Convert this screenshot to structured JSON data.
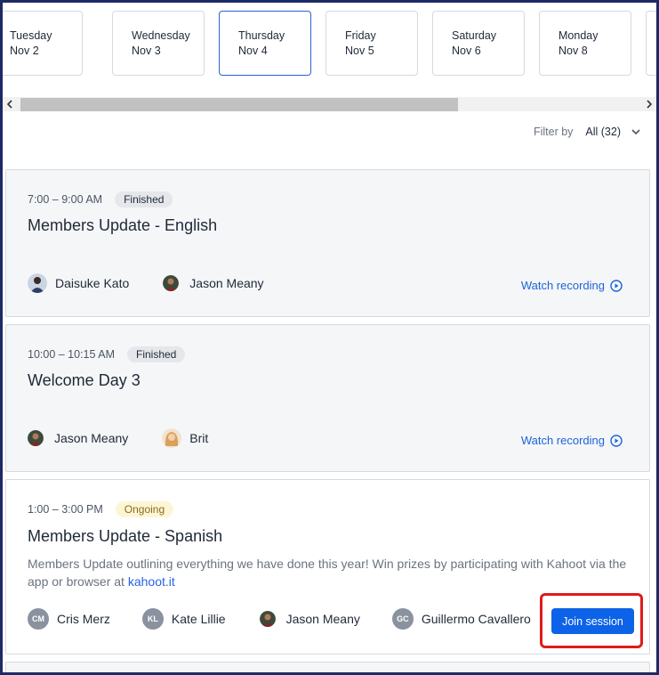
{
  "days": [
    {
      "name": "Tuesday",
      "date": "Nov 2"
    },
    {
      "name": "Wednesday",
      "date": "Nov 3"
    },
    {
      "name": "Thursday",
      "date": "Nov 4"
    },
    {
      "name": "Friday",
      "date": "Nov 5"
    },
    {
      "name": "Saturday",
      "date": "Nov 6"
    },
    {
      "name": "Monday",
      "date": "Nov 8"
    }
  ],
  "selected_day": "Thursday",
  "filter": {
    "label": "Filter by",
    "value": "All (32)"
  },
  "sessions": [
    {
      "time": "7:00 – 9:00 AM",
      "status": "Finished",
      "title": "Members Update - English",
      "speakers": [
        {
          "name": "Daisuke Kato",
          "avatar": "photo-avatar"
        },
        {
          "name": "Jason Meany",
          "avatar": "photo-avatar"
        }
      ],
      "action": "Watch recording"
    },
    {
      "time": "10:00 – 10:15 AM",
      "status": "Finished",
      "title": "Welcome Day 3",
      "speakers": [
        {
          "name": "Jason Meany",
          "avatar": "photo-avatar"
        },
        {
          "name": "Brit",
          "avatar": "photo-avatar"
        }
      ],
      "action": "Watch recording"
    },
    {
      "time": "1:00 – 3:00 PM",
      "status": "Ongoing",
      "title": "Members Update - Spanish",
      "description": "Members Update outlining everything we have done this year! Win prizes by participating with Kahoot via the app or browser at",
      "description_link": "kahoot.it",
      "speakers": [
        {
          "name": "Cris Merz",
          "initials": "CM"
        },
        {
          "name": "Kate Lillie",
          "initials": "KL"
        },
        {
          "name": "Jason Meany",
          "avatar": "photo-avatar"
        },
        {
          "name": "Guillermo Cavallero",
          "initials": "GC"
        }
      ],
      "action": "Join session"
    }
  ],
  "colors": {
    "accent": "#0d63e8",
    "link": "#1d64d8",
    "highlight_border": "#e01b1b",
    "ongoing_badge_bg": "#fdf6d6",
    "finished_badge_bg": "#e5e7eb"
  }
}
